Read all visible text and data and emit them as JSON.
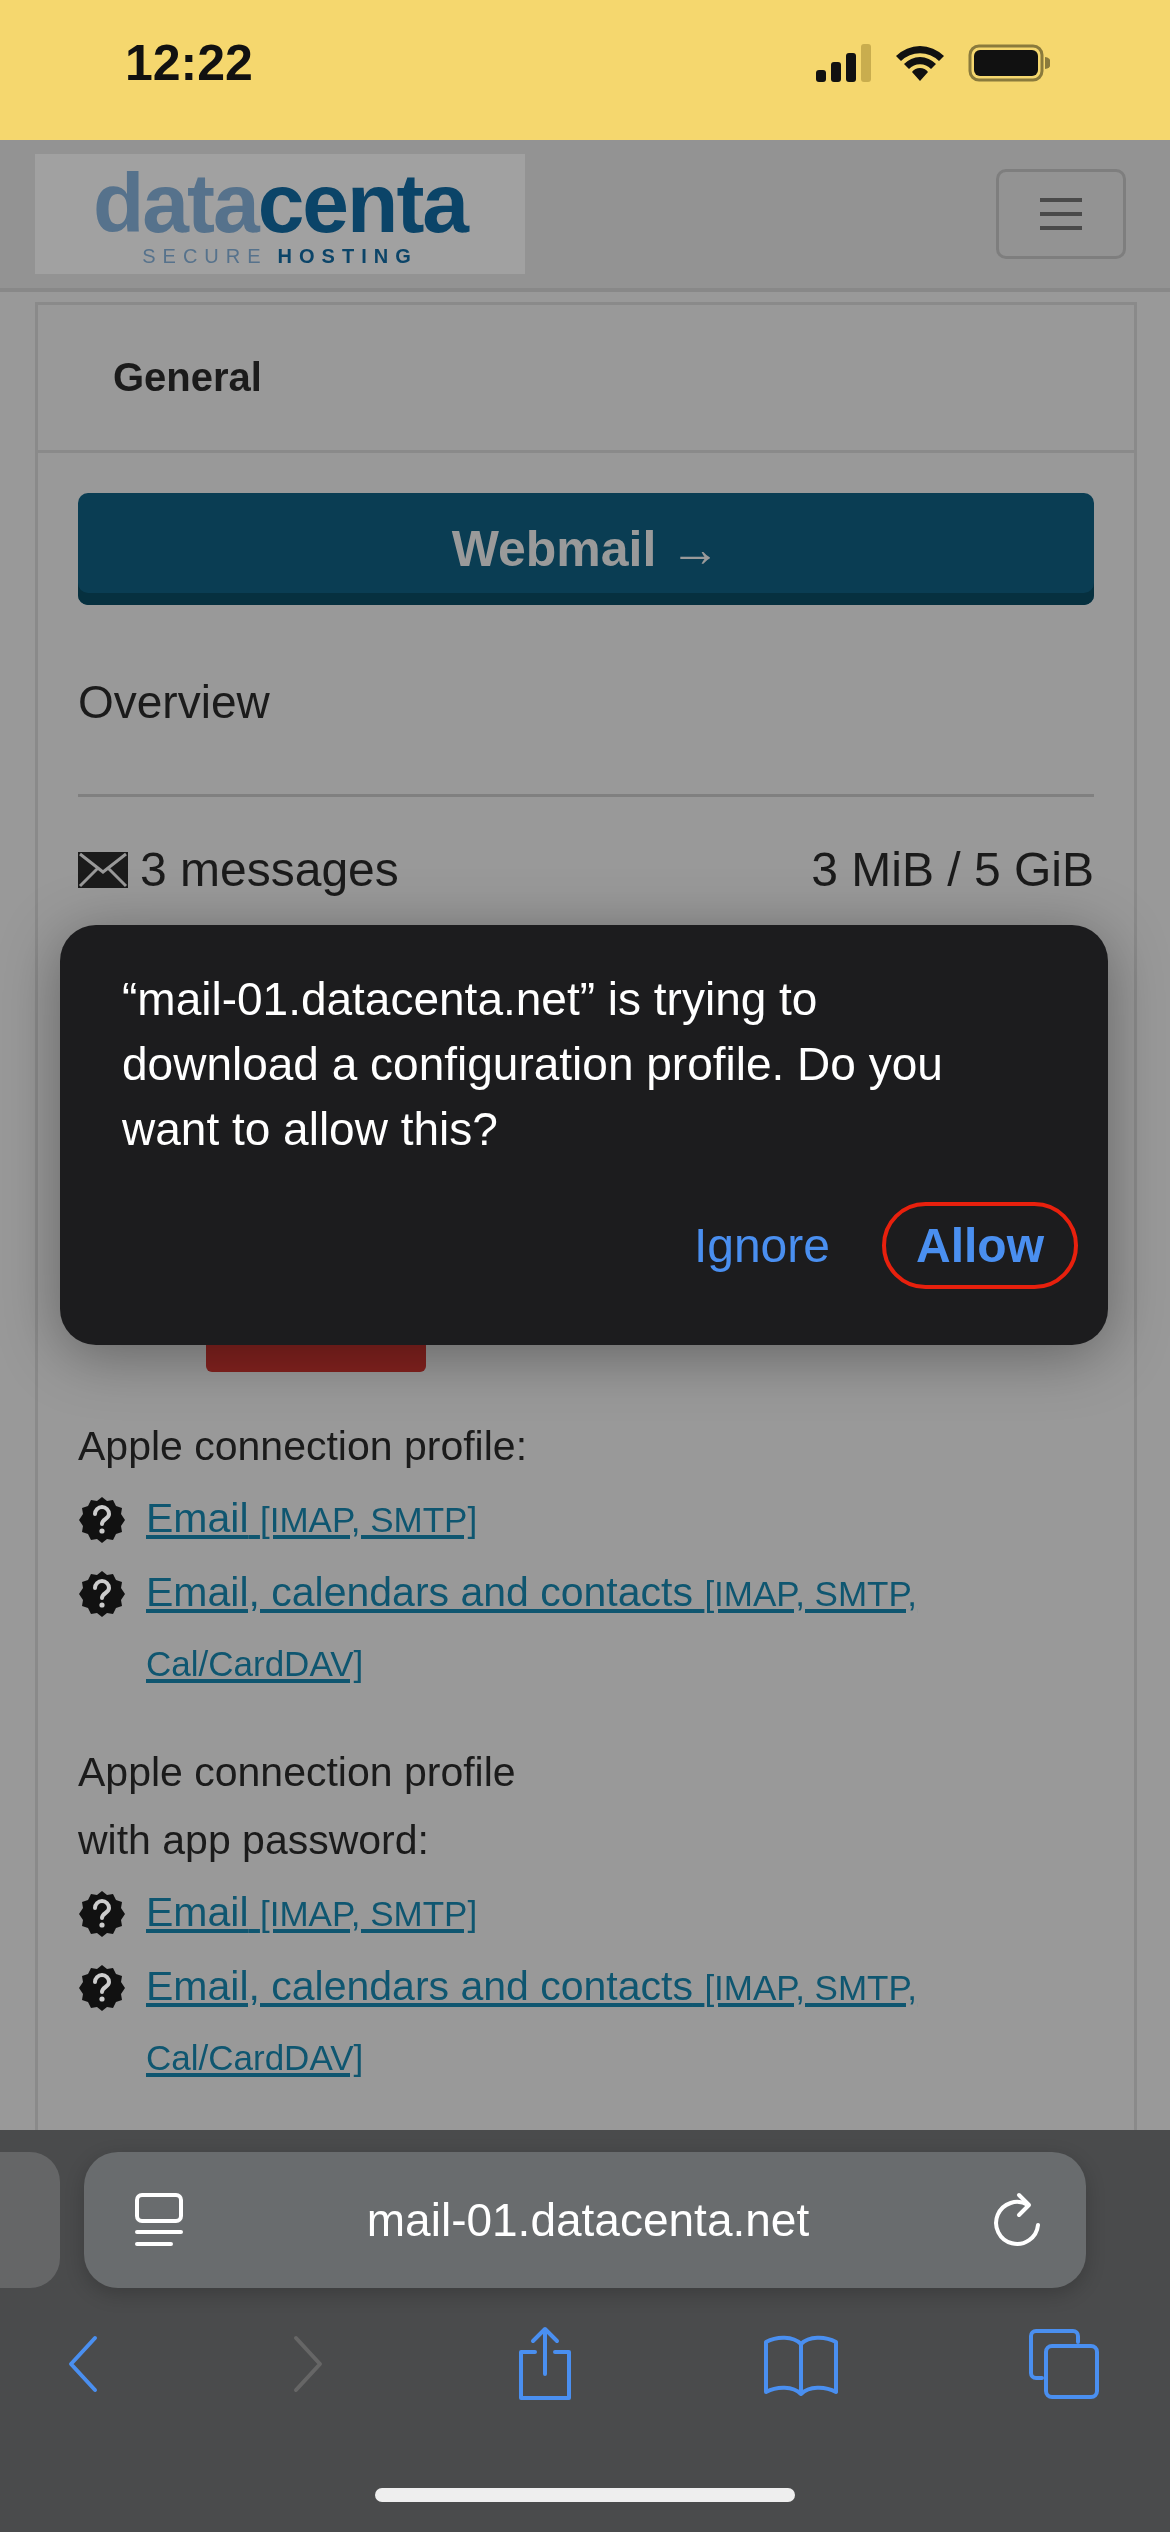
{
  "status_bar": {
    "time": "12:22"
  },
  "header": {
    "logo": {
      "word_start": "data",
      "word_end": "centa",
      "tagline_start": "SECURE",
      "tagline_end": "HOSTING"
    }
  },
  "tabs": [
    {
      "label": "General",
      "selected": true
    }
  ],
  "webmail_button": {
    "label": "Webmail →"
  },
  "overview": {
    "title": "Overview",
    "messages": "3 messages",
    "storage": "3 MiB / 5 GiB"
  },
  "profiles": [
    {
      "title": "Apple connection profile:",
      "links": [
        {
          "label": "Email",
          "protocols": "[IMAP, SMTP]"
        },
        {
          "label": "Email, calendars and contacts",
          "protocols": "[IMAP, SMTP, Cal/CardDAV]"
        }
      ]
    },
    {
      "title": "Apple connection profile with app password:",
      "links": [
        {
          "label": "Email",
          "protocols": "[IMAP, SMTP]"
        },
        {
          "label": "Email, calendars and contacts",
          "protocols": "[IMAP, SMTP, Cal/CardDAV]"
        }
      ]
    }
  ],
  "dialog": {
    "message": "“mail-01.datacenta.net” is trying to download a configuration profile. Do you want to allow this?",
    "buttons": [
      {
        "label": "Ignore",
        "kind": "default",
        "highlighted": false
      },
      {
        "label": "Allow",
        "kind": "primary",
        "highlighted": true
      }
    ]
  },
  "address_bar": {
    "url": "mail-01.datacenta.net"
  },
  "toolbar": [
    {
      "kind": "back",
      "disabled": false
    },
    {
      "kind": "forward",
      "disabled": true
    },
    {
      "kind": "share",
      "disabled": false
    },
    {
      "kind": "bookmarks",
      "disabled": false
    },
    {
      "kind": "tabs",
      "disabled": false
    }
  ]
}
